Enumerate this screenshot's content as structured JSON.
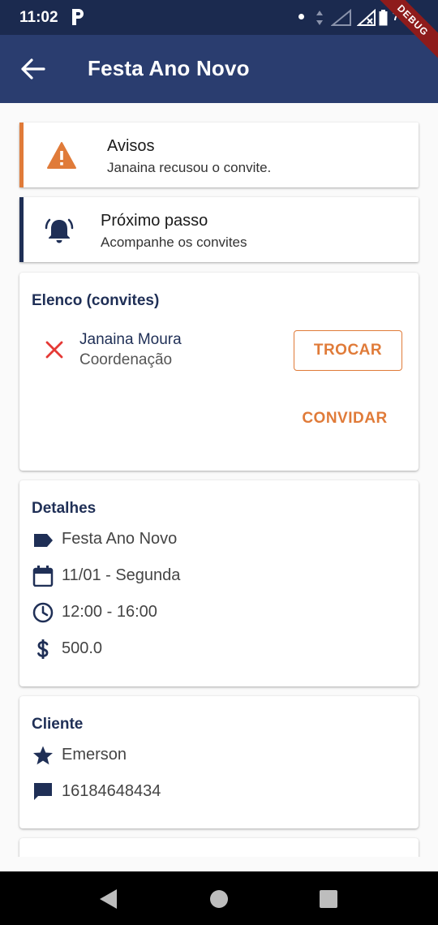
{
  "status_bar": {
    "time": "11:02",
    "app_icon": "parking-p-icon",
    "battery_pct": "75%",
    "debug_label": "DEBUG"
  },
  "app_bar": {
    "title": "Festa Ano Novo",
    "back_icon": "arrow-back-icon",
    "background": "#2a3d6f"
  },
  "notices": [
    {
      "title": "Avisos",
      "subtitle": "Janaina recusou o convite.",
      "icon": "warning-icon",
      "accent": "#e07b39"
    },
    {
      "title": "Próximo passo",
      "subtitle": "Acompanhe os convites",
      "icon": "bell-ring-icon",
      "accent": "#1f2f56"
    }
  ],
  "cast": {
    "title": "Elenco (convites)",
    "member": {
      "name": "Janaina Moura",
      "role": "Coordenação",
      "status_icon": "close-x-icon",
      "status_color": "#e53935"
    },
    "swap_label": "TROCAR",
    "invite_label": "CONVIDAR"
  },
  "details": {
    "title": "Detalhes",
    "rows": [
      {
        "icon": "label-tag-icon",
        "text": "Festa Ano Novo"
      },
      {
        "icon": "calendar-icon",
        "text": "11/01 - Segunda"
      },
      {
        "icon": "clock-icon",
        "text": "12:00 - 16:00"
      },
      {
        "icon": "dollar-icon",
        "text": "500.0"
      }
    ]
  },
  "client": {
    "title": "Cliente",
    "rows": [
      {
        "icon": "star-icon",
        "text": "Emerson"
      },
      {
        "icon": "message-icon",
        "text": "16184648434"
      }
    ]
  },
  "colors": {
    "primary": "#2a3d6f",
    "status_bar": "#1b2a4f",
    "accent": "#e07b39",
    "dark_text": "#1f2f56"
  }
}
